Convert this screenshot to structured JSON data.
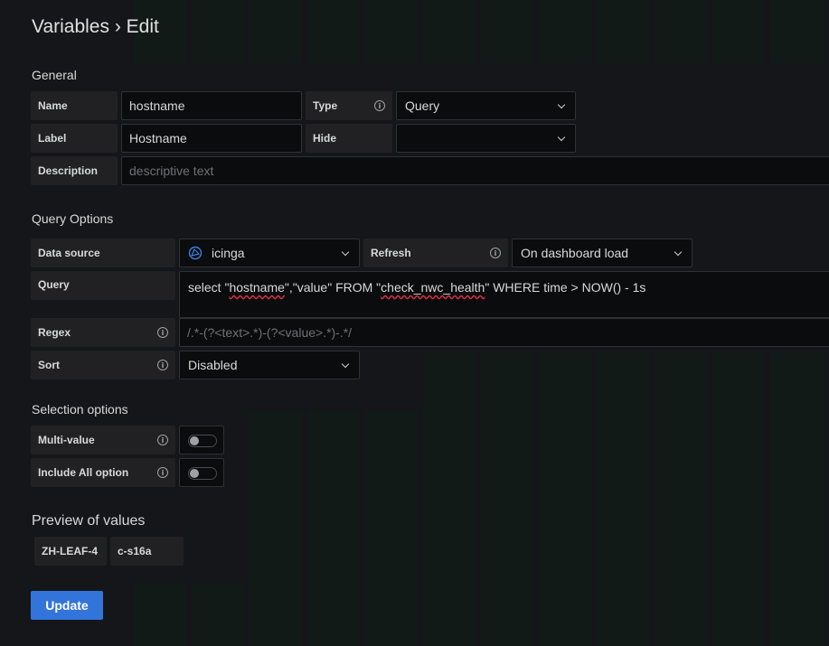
{
  "page": {
    "title": "Variables › Edit"
  },
  "general": {
    "heading": "General",
    "name_label": "Name",
    "name_value": "hostname",
    "type_label": "Type",
    "type_value": "Query",
    "label_label": "Label",
    "label_value": "Hostname",
    "hide_label": "Hide",
    "hide_value": "",
    "description_label": "Description",
    "description_placeholder": "descriptive text"
  },
  "query_options": {
    "heading": "Query Options",
    "datasource_label": "Data source",
    "datasource_value": "icinga",
    "refresh_label": "Refresh",
    "refresh_value": "On dashboard load",
    "query_label": "Query",
    "query_part1": "select \"",
    "query_part2": "hostname",
    "query_part3": "\",\"value\" FROM \"",
    "query_part4": "check_nwc_health",
    "query_part5": "\" WHERE time > NOW() - 1s",
    "regex_label": "Regex",
    "regex_placeholder": "/.*-(?<text>.*)-(?<value>.*)-.*/",
    "sort_label": "Sort",
    "sort_value": "Disabled"
  },
  "selection_options": {
    "heading": "Selection options",
    "multi_value_label": "Multi-value",
    "multi_value_on": false,
    "include_all_label": "Include All option",
    "include_all_on": false
  },
  "preview": {
    "heading": "Preview of values",
    "values": [
      "ZH-LEAF-4",
      "c-s16a"
    ]
  },
  "actions": {
    "update_label": "Update"
  },
  "colors": {
    "primary": "#3274d9",
    "background": "#141619"
  }
}
